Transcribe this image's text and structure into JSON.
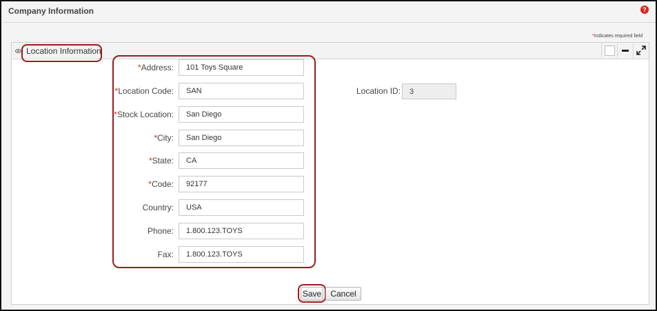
{
  "page": {
    "title": "Company Information",
    "help_icon": "question-circle-icon",
    "required_note": {
      "star": "*",
      "text": "Indicates required field"
    }
  },
  "panel": {
    "title": "Location Information",
    "icons": [
      "eye-icon",
      "square-icon",
      "minus-icon",
      "expand-icon"
    ]
  },
  "form": {
    "fields": [
      {
        "required": "*",
        "label": "Address:",
        "value": "101 Toys Square"
      },
      {
        "required": "*",
        "label": "Location Code:",
        "value": "SAN"
      },
      {
        "required": "*",
        "label": "Stock Location:",
        "value": "San Diego"
      },
      {
        "required": "*",
        "label": "City:",
        "value": "San Diego"
      },
      {
        "required": "*",
        "label": "State:",
        "value": "CA"
      },
      {
        "required": "*",
        "label": "Code:",
        "value": "92177"
      },
      {
        "required": "",
        "label": "Country:",
        "value": "USA"
      },
      {
        "required": "",
        "label": "Phone:",
        "value": "1.800.123.TOYS"
      },
      {
        "required": "",
        "label": "Fax:",
        "value": "1.800.123.TOYS"
      }
    ],
    "location_id": {
      "label": "Location ID:",
      "value": "3"
    }
  },
  "buttons": {
    "save": "Save",
    "cancel": "Cancel"
  },
  "colors": {
    "required_star": "#d9251d",
    "highlight": "#9b1b1b"
  }
}
